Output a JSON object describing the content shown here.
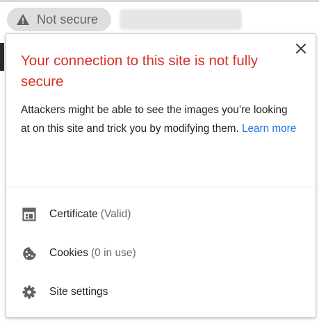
{
  "omnibox": {
    "security_chip_label": "Not secure",
    "security_chip_icon": "warning-triangle-icon"
  },
  "popup": {
    "title": "Your connection to this site is not fully secure",
    "body": "Attackers might be able to see the images you’re looking at on this site and trick you by modifying them.",
    "learn_more": "Learn more",
    "close_icon": "close-icon",
    "items": [
      {
        "label": "Certificate",
        "detail": "(Valid)",
        "icon": "certificate-icon"
      },
      {
        "label": "Cookies",
        "detail": "(0 in use)",
        "icon": "cookie-icon"
      },
      {
        "label": "Site settings",
        "detail": "",
        "icon": "gear-icon"
      }
    ]
  },
  "colors": {
    "title_red": "#d93025",
    "link_blue": "#1a73e8",
    "chip_bg": "#dedede",
    "icon_grey": "#5f6368"
  }
}
